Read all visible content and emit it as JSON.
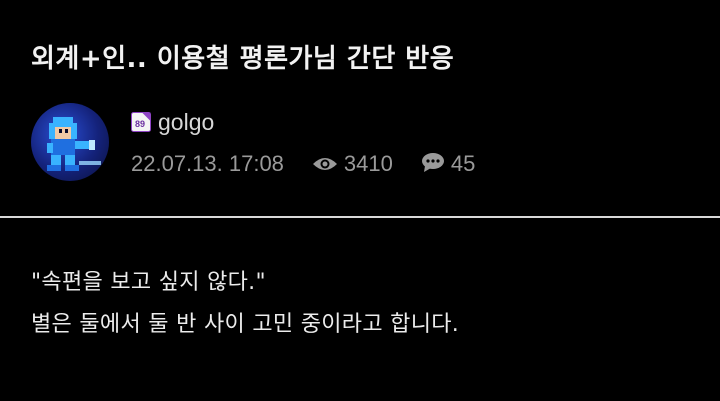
{
  "post": {
    "title": "외계+인.. 이용철 평론가님 간단 반응",
    "author": {
      "name": "golgo",
      "level_badge": "89",
      "avatar_icon": "megaman-avatar-icon"
    },
    "date": "22.07.13. 17:08",
    "views": "3410",
    "comments": "45",
    "body": [
      "\"속편을 보고 싶지 않다.\"",
      "별은 둘에서 둘 반 사이 고민 중이라고 합니다."
    ]
  },
  "colors": {
    "background": "#000000",
    "title": "#f2f2f2",
    "meta": "#9a9a9a",
    "badge": "#8e44c4",
    "divider": "#d9d9d9"
  }
}
